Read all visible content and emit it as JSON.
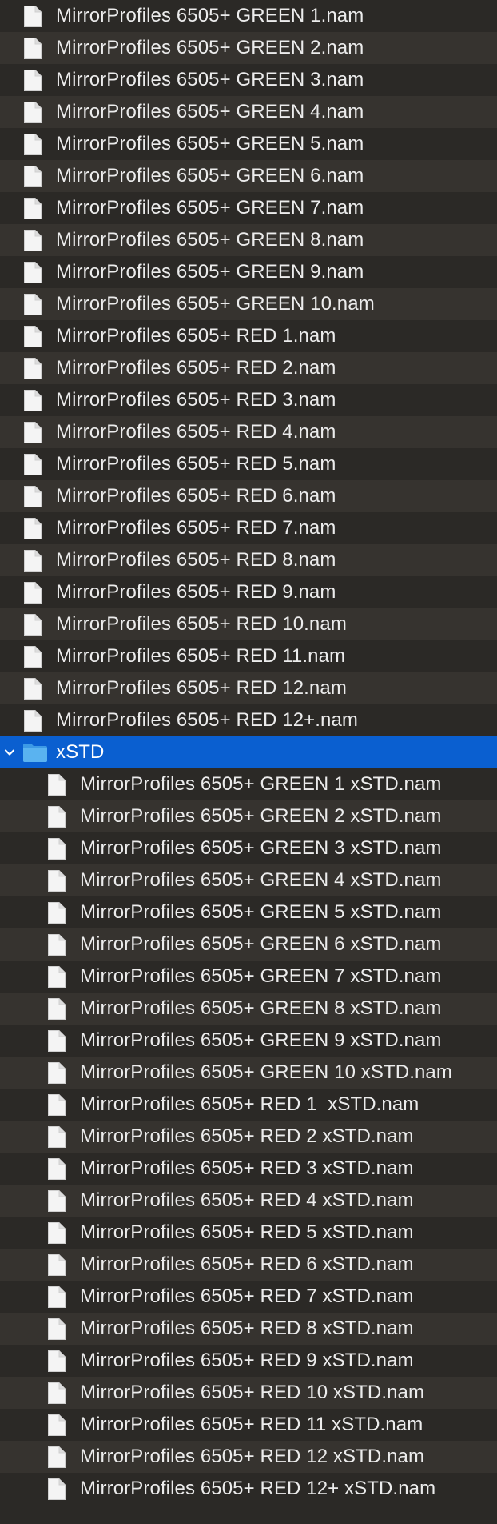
{
  "file_list": {
    "top_files": [
      "MirrorProfiles 6505+ GREEN 1.nam",
      "MirrorProfiles 6505+ GREEN 2.nam",
      "MirrorProfiles 6505+ GREEN 3.nam",
      "MirrorProfiles 6505+ GREEN 4.nam",
      "MirrorProfiles 6505+ GREEN 5.nam",
      "MirrorProfiles 6505+ GREEN 6.nam",
      "MirrorProfiles 6505+ GREEN 7.nam",
      "MirrorProfiles 6505+ GREEN 8.nam",
      "MirrorProfiles 6505+ GREEN 9.nam",
      "MirrorProfiles 6505+ GREEN 10.nam",
      "MirrorProfiles 6505+ RED 1.nam",
      "MirrorProfiles 6505+ RED 2.nam",
      "MirrorProfiles 6505+ RED 3.nam",
      "MirrorProfiles 6505+ RED 4.nam",
      "MirrorProfiles 6505+ RED 5.nam",
      "MirrorProfiles 6505+ RED 6.nam",
      "MirrorProfiles 6505+ RED 7.nam",
      "MirrorProfiles 6505+ RED 8.nam",
      "MirrorProfiles 6505+ RED 9.nam",
      "MirrorProfiles 6505+ RED 10.nam",
      "MirrorProfiles 6505+ RED 11.nam",
      "MirrorProfiles 6505+ RED 12.nam",
      "MirrorProfiles 6505+ RED 12+.nam"
    ],
    "folder": {
      "name": "xSTD",
      "expanded": true,
      "selected": true,
      "icon": "folder-icon",
      "disclosure_icon": "chevron-down-icon",
      "files": [
        "MirrorProfiles 6505+ GREEN 1 xSTD.nam",
        "MirrorProfiles 6505+ GREEN 2 xSTD.nam",
        "MirrorProfiles 6505+ GREEN 3 xSTD.nam",
        "MirrorProfiles 6505+ GREEN 4 xSTD.nam",
        "MirrorProfiles 6505+ GREEN 5 xSTD.nam",
        "MirrorProfiles 6505+ GREEN 6 xSTD.nam",
        "MirrorProfiles 6505+ GREEN 7 xSTD.nam",
        "MirrorProfiles 6505+ GREEN 8 xSTD.nam",
        "MirrorProfiles 6505+ GREEN 9 xSTD.nam",
        "MirrorProfiles 6505+ GREEN 10 xSTD.nam",
        "MirrorProfiles 6505+ RED 1  xSTD.nam",
        "MirrorProfiles 6505+ RED 2 xSTD.nam",
        "MirrorProfiles 6505+ RED 3 xSTD.nam",
        "MirrorProfiles 6505+ RED 4 xSTD.nam",
        "MirrorProfiles 6505+ RED 5 xSTD.nam",
        "MirrorProfiles 6505+ RED 6 xSTD.nam",
        "MirrorProfiles 6505+ RED 7 xSTD.nam",
        "MirrorProfiles 6505+ RED 8 xSTD.nam",
        "MirrorProfiles 6505+ RED 9 xSTD.nam",
        "MirrorProfiles 6505+ RED 10 xSTD.nam",
        "MirrorProfiles 6505+ RED 11 xSTD.nam",
        "MirrorProfiles 6505+ RED 12 xSTD.nam",
        "MirrorProfiles 6505+ RED 12+ xSTD.nam"
      ]
    },
    "file_icon": "document-icon"
  },
  "colors": {
    "row_even": "#2b2926",
    "row_odd": "#36332f",
    "selection": "#0a5fd0",
    "text": "#ececec",
    "folder": "#5ab3f0"
  }
}
